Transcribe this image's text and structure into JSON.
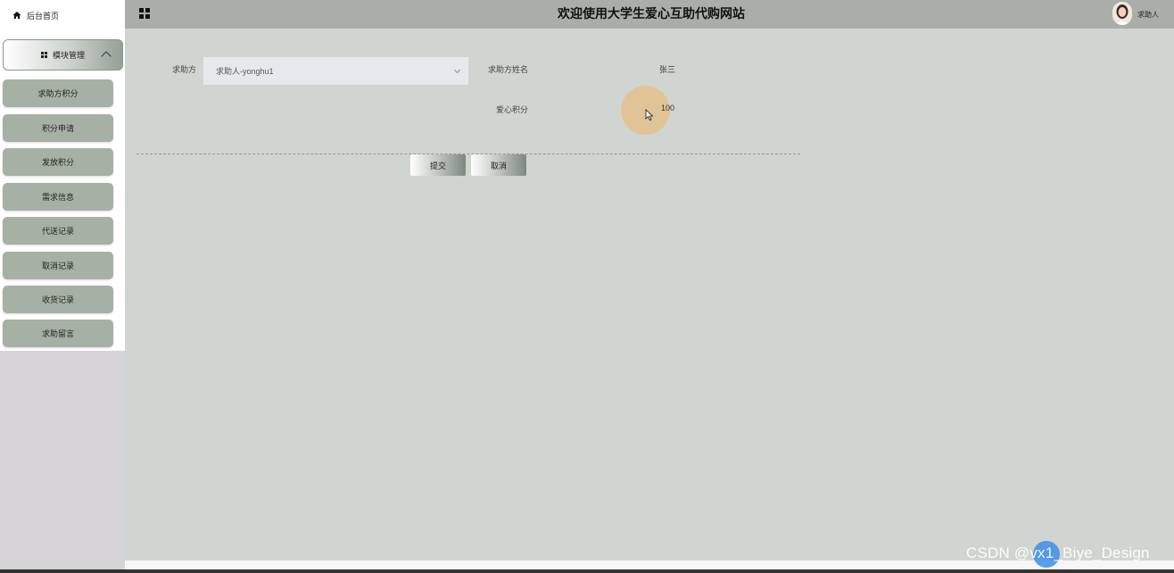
{
  "sidebar": {
    "home_label": "后台首页",
    "group_label": "模块管理",
    "items": [
      "求助方积分",
      "积分申请",
      "发放积分",
      "需求信息",
      "代送记录",
      "取消记录",
      "收货记录",
      "求助留言"
    ]
  },
  "header": {
    "title": "欢迎使用大学生爱心互助代购网站",
    "user_name": "求助人"
  },
  "form": {
    "seeker_label": "求助方",
    "seeker_value": "求助人-yonghu1",
    "name_label": "求助方姓名",
    "name_value": "张三",
    "points_label": "爱心积分",
    "points_value": "100",
    "submit_label": "提交",
    "cancel_label": "取消"
  },
  "watermark": "CSDN @vx1_Biye_Design",
  "colors": {
    "sidebar_item": "#a6b1a6",
    "header": "#a9aea9",
    "main_bg": "#d1d5d1"
  }
}
